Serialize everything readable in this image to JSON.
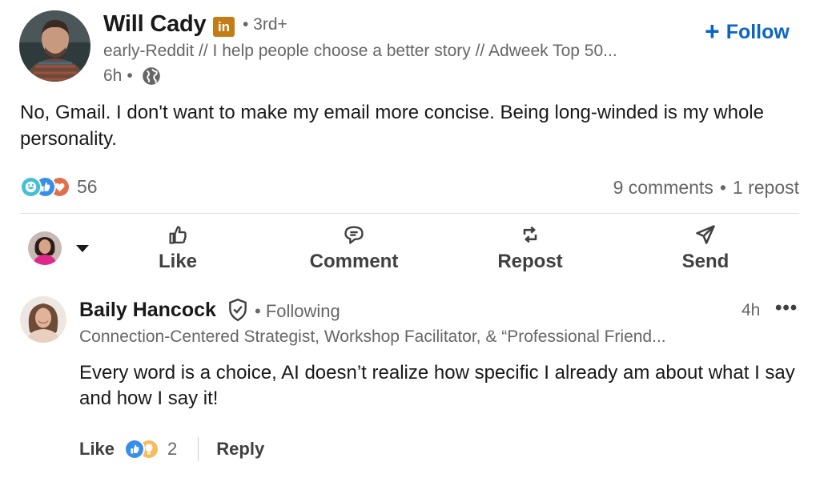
{
  "author": {
    "name": "Will Cady",
    "badge": "in",
    "degree": "• 3rd+",
    "headline": "early-Reddit // I help people choose a better story // Adweek Top 50...",
    "time": "6h",
    "dot": "•",
    "visibility_icon": "globe-icon"
  },
  "follow": {
    "plus": "+",
    "label": "Follow"
  },
  "post": {
    "text": "No, Gmail. I don't want to make my email more concise. Being long-winded is my whole personality."
  },
  "social": {
    "reaction_icons": [
      "funny-reaction-icon",
      "like-reaction-icon",
      "love-reaction-icon"
    ],
    "reaction_count": "56",
    "comments": "9 comments",
    "sep": "•",
    "reposts": "1 repost"
  },
  "actions": {
    "like": "Like",
    "comment": "Comment",
    "repost": "Repost",
    "send": "Send"
  },
  "comment": {
    "name": "Baily Hancock",
    "following": "• Following",
    "time": "4h",
    "more": "•••",
    "headline": "Connection-Centered Strategist, Workshop Facilitator, & “Professional Friend...",
    "text": "Every word is a choice, AI doesn’t realize how specific I already am about what I say and how I say it!",
    "like_label": "Like",
    "reaction_icons": [
      "like-reaction-icon",
      "insightful-reaction-icon"
    ],
    "reaction_count": "2",
    "reply_label": "Reply"
  },
  "colors": {
    "brand_blue": "#0a66c2",
    "premium_gold": "#c37d16",
    "love_red": "#df704d",
    "insightful_yellow": "#f5bb5c",
    "funny_teal": "#44bfd3"
  }
}
